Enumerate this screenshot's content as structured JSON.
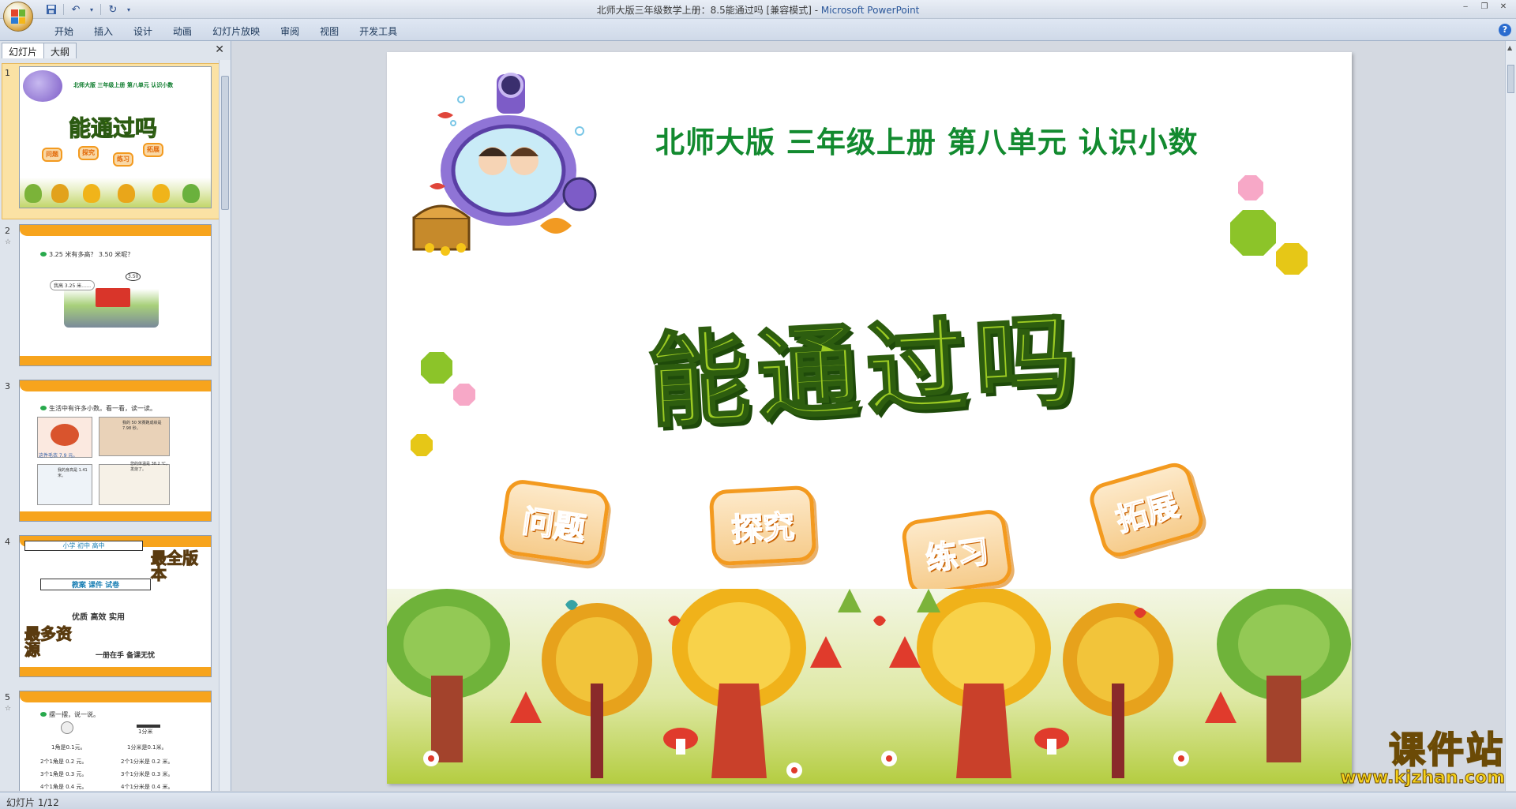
{
  "window": {
    "title": "北师大版三年级数学上册：8.5能通过吗 [兼容模式]",
    "app_name": "Microsoft PowerPoint",
    "controls": [
      "‒",
      "❐",
      "✕"
    ]
  },
  "ribbon": {
    "tabs": [
      "开始",
      "插入",
      "设计",
      "动画",
      "幻灯片放映",
      "审阅",
      "视图",
      "开发工具"
    ]
  },
  "left_pane": {
    "tabs": [
      "幻灯片",
      "大纲"
    ],
    "close_label": "✕",
    "slides": [
      {
        "number": "1",
        "subtitle": "北师大版  三年级上册  第八单元  认识小数",
        "title": "能通过吗",
        "badges": [
          "问题",
          "探究",
          "练习",
          "拓展"
        ]
      },
      {
        "number": "2",
        "text": "3.25 米有多高？ 3.50 米呢？",
        "bubble": "我高 3.25 米……",
        "sign": "3.50"
      },
      {
        "number": "3",
        "text": "生活中有许多小数。看一看，读一读。",
        "bubbles": [
          "这件毛衣 7.9 元。",
          "我的 50 米赛跑成绩是 7.98 秒。",
          "我的身高是 1.41 米。",
          "您的体温是 38.2 ℃，发烧了。"
        ]
      },
      {
        "number": "4",
        "lines": [
          "小学 初中 高中",
          "教案 课件 试卷",
          "优质 高效 实用",
          "一册在手 备课无忧"
        ],
        "side1": "最全版本",
        "side2": "最多资源"
      },
      {
        "number": "5",
        "text": "摆一摆，说一说。",
        "rows": [
          [
            "1角是0.1元。",
            "1分米是0.1米。"
          ],
          [
            "2个1角是 0.2 元。",
            "2个1分米是 0.2 米。"
          ],
          [
            "3个1角是 0.3 元。",
            "3个1分米是 0.3 米。"
          ],
          [
            "4个1角是 0.4 元。",
            "4个1分米是 0.4 米。"
          ]
        ],
        "label": "1分米"
      }
    ]
  },
  "slide": {
    "subtitle": "北师大版  三年级上册  第八单元  认识小数",
    "title": "能通过吗",
    "badges": [
      "问题",
      "探究",
      "练习",
      "拓展"
    ],
    "colors": {
      "title_fill": "#9dcb23",
      "subtitle": "#128a2f",
      "badge_border": "#f39a1f"
    }
  },
  "watermark": {
    "name": "课件站",
    "url": "www.kjzhan.com"
  },
  "status": {
    "slide_position": "幻灯片 1/12"
  }
}
